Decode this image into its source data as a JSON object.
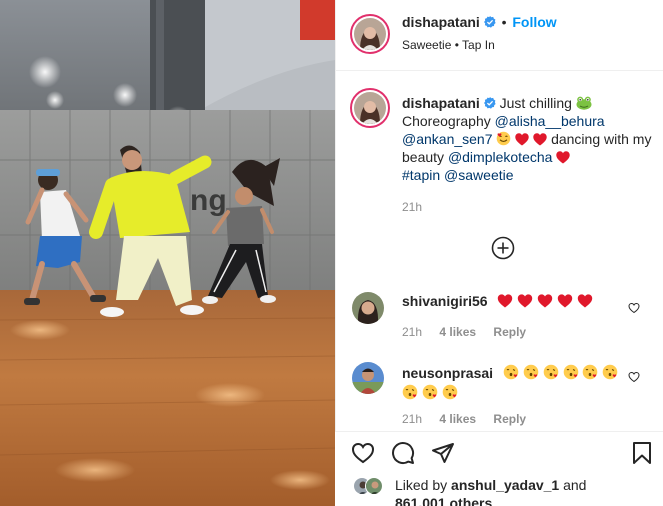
{
  "post": {
    "username": "dishapatani",
    "follow_label": "Follow",
    "separator": "•",
    "audio_artist": "Saweetie",
    "audio_track": "Tap In",
    "media_overlay_text": "ng"
  },
  "caption": {
    "username": "dishapatani",
    "text1": "Just chilling",
    "text2": "Choreography",
    "mention1": "@alisha__behura",
    "mention2": "@ankan_sen7",
    "text3": "dancing with my beauty",
    "mention3": "@dimplekotecha",
    "hashtag": "#tapin",
    "mention4": "@saweetie",
    "time": "21h"
  },
  "comments": [
    {
      "username": "shivanigiri56",
      "time": "21h",
      "likes": "4 likes",
      "reply": "Reply"
    },
    {
      "username": "neusonprasai",
      "time": "21h",
      "likes": "4 likes",
      "reply": "Reply"
    }
  ],
  "footer": {
    "liked_by_prefix": "Liked by",
    "liked_by_user": "anshul_yadav_1",
    "liked_by_suffix": "and",
    "others": "861,001 others"
  },
  "icons": {
    "verified": "verified-badge-icon",
    "add_comments": "load-more-comments-icon",
    "like": "heart-outline-icon",
    "comment": "comment-bubble-icon",
    "share": "paper-plane-icon",
    "save": "bookmark-icon",
    "comment_like": "small-heart-icon"
  },
  "colors": {
    "link_blue": "#0095f6",
    "mention": "#00376b",
    "secondary_text": "#8e8e8e",
    "heart_red": "#e0182b",
    "ring": "#e1306c"
  }
}
